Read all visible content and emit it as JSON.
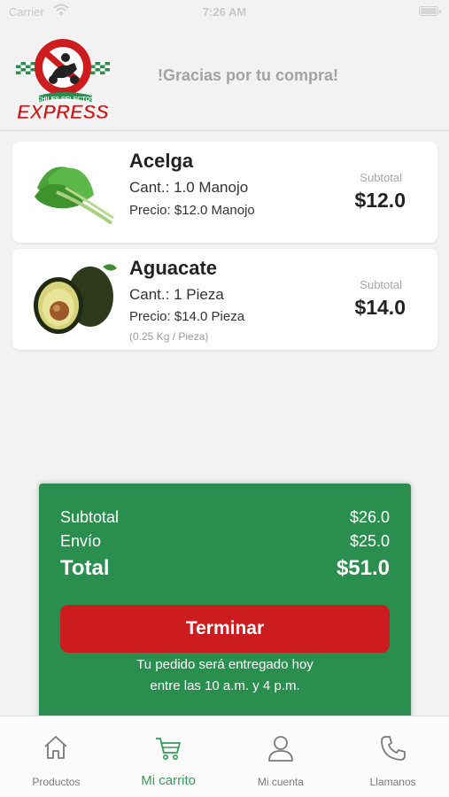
{
  "status_bar": {
    "carrier": "Carrier",
    "time": "7:26 AM"
  },
  "header": {
    "logo": {
      "line1": "CHILES SELECTOS",
      "line2": "EXPRESS"
    },
    "thanks": "!Gracias por tu compra!"
  },
  "items": [
    {
      "image": "chard-image",
      "name": "Acelga",
      "qty": "Cant.: 1.0 Manojo",
      "price": "Precio: $12.0 Manojo",
      "note": "",
      "subtotal_label": "Subtotal",
      "subtotal": "$12.0"
    },
    {
      "image": "avocado-image",
      "name": "Aguacate",
      "qty": "Cant.: 1 Pieza",
      "price": "Precio: $14.0 Pieza",
      "note": "(0.25 Kg / Pieza)",
      "subtotal_label": "Subtotal",
      "subtotal": "$14.0"
    }
  ],
  "summary": {
    "subtotal_label": "Subtotal",
    "subtotal": "$26.0",
    "shipping_label": "Envío",
    "shipping": "$25.0",
    "total_label": "Total",
    "total": "$51.0",
    "finish_label": "Terminar",
    "delivery_line1": "Tu pedido será entregado hoy",
    "delivery_line2": "entre las 10 a.m. y 4 p.m."
  },
  "tabs": [
    {
      "icon": "home-icon",
      "label": "Productos",
      "active": false
    },
    {
      "icon": "cart-icon",
      "label": "Mi carrito",
      "active": true
    },
    {
      "icon": "user-icon",
      "label": "Mi cuenta",
      "active": false
    },
    {
      "icon": "phone-icon",
      "label": "Llamanos",
      "active": false
    }
  ],
  "colors": {
    "brand_green": "#2a8e4e",
    "brand_red": "#cc1c1e",
    "active_tab": "#3a9a57",
    "background": "#f2f2f2"
  }
}
